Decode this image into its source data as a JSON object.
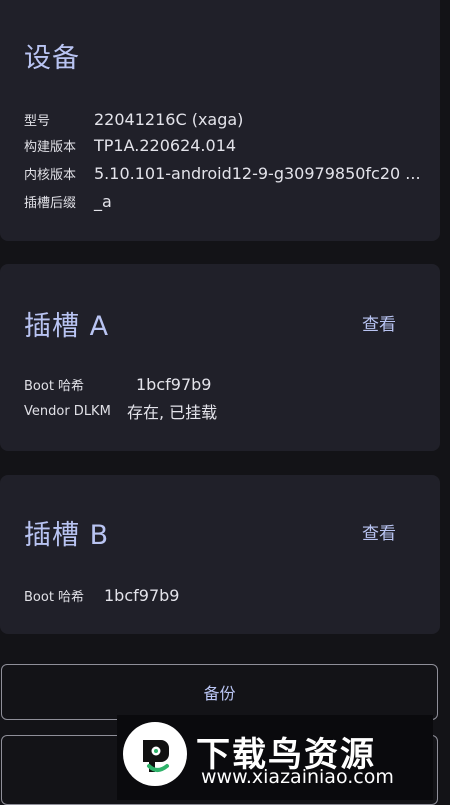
{
  "device": {
    "title": "设备",
    "rows": [
      {
        "label": "型号",
        "value": "22041216C (xaga)"
      },
      {
        "label": "构建版本",
        "value": "TP1A.220624.014"
      },
      {
        "label": "内核版本",
        "value": "5.10.101-android12-9-g30979850fc20 ..."
      },
      {
        "label": "插槽后缀",
        "value": "_a"
      }
    ]
  },
  "slot_a": {
    "title": "插槽 A",
    "view_label": "查看",
    "rows": [
      {
        "label": "Boot 哈希",
        "value": "1bcf97b9"
      },
      {
        "label": "Vendor DLKM",
        "value": "存在, 已挂载"
      }
    ]
  },
  "slot_b": {
    "title": "插槽 B",
    "view_label": "查看",
    "rows": [
      {
        "label": "Boot 哈希",
        "value": "1bcf97b9"
      }
    ]
  },
  "actions": {
    "backup_label": "备份"
  },
  "watermark": {
    "title": "下载鸟资源",
    "url": "www.xiazainiao.com"
  },
  "colors": {
    "accent": "#b9c4f2",
    "card": "#202029",
    "background": "#131317"
  }
}
